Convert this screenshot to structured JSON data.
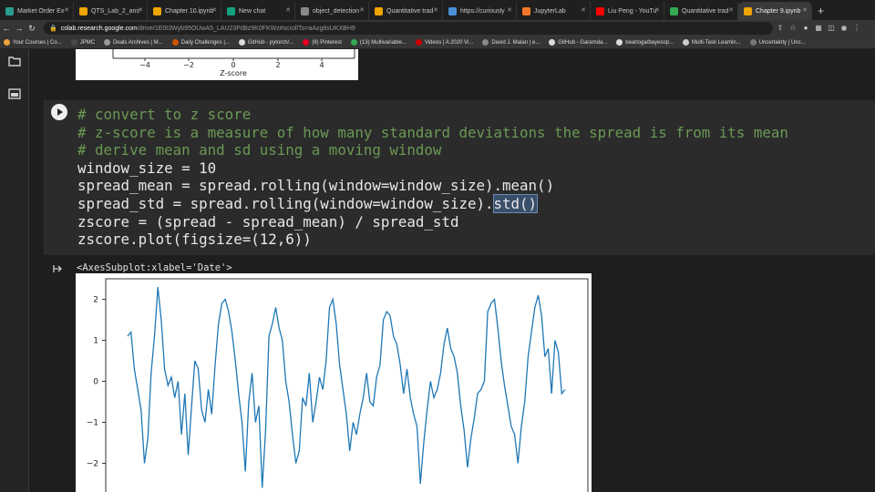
{
  "browser": {
    "tabs": [
      {
        "label": "Market Order Ex",
        "color": "#2a9d8f"
      },
      {
        "label": "QTS_Lab_2_ans",
        "color": "#f0a500"
      },
      {
        "label": "Chapter 10.ipynb",
        "color": "#f0a500"
      },
      {
        "label": "New chat",
        "color": "#10a37f"
      },
      {
        "label": "object_detection",
        "color": "#888888"
      },
      {
        "label": "Quantitative trad",
        "color": "#f0a500"
      },
      {
        "label": "https://curiously",
        "color": "#4a90d9"
      },
      {
        "label": "JupyterLab",
        "color": "#f37726"
      },
      {
        "label": "Liu Peng - YouTu",
        "color": "#ff0000"
      },
      {
        "label": "Quantitative trad",
        "color": "#34a853"
      },
      {
        "label": "Chapter 9.ipynb",
        "color": "#f0a500"
      }
    ],
    "new_tab": "+",
    "url_host": "colab.research.google.com",
    "url_path": "/drive/1E0t3Wyb95OUwA5_LAU23Pd8z9K0FKWz#scrollTo=aAzg8sUKXBH9",
    "bookmarks": [
      "Your Courses | Co...",
      "JPMC",
      "Deals Archives | M...",
      "Daily Challenges |...",
      "GitHub - pytorch/...",
      "(8) Pinterest",
      "(13) Multivariable...",
      "Videos | A 2020 Vi...",
      "David J. Malan | e...",
      "GitHub - Garamda...",
      "bearloga/bayesop...",
      "Multi-Task Learnin...",
      "Uncertainty | Unc..."
    ]
  },
  "notebook": {
    "prev_axis_ticks": [
      "−4",
      "−2",
      "0",
      "2",
      "4"
    ],
    "prev_axis_label": "Z-score",
    "code_lines": {
      "c1": "# convert to z score",
      "c2": "# z-score is a measure of how many standard deviations the spread is from its mean",
      "c3": "# derive mean and sd using a moving window",
      "l4": "window_size = 10",
      "l5": "spread_mean = spread.rolling(window=window_size).mean()",
      "l6a": "spread_std = spread.rolling(window=window_size).",
      "l6b": "std()",
      "l7": "zscore = (spread - spread_mean) / spread_std",
      "l8": "zscore.plot(figsize=(12,6))"
    },
    "output_text": "<AxesSubplot:xlabel='Date'>"
  },
  "chart_data": {
    "type": "line",
    "ylim": [
      -2.7,
      2.5
    ],
    "yticks": [
      2,
      1,
      0,
      -1,
      -2
    ],
    "color": "#1f77b4",
    "values": [
      1.1,
      1.2,
      0.3,
      -0.2,
      -0.7,
      -2.0,
      -1.4,
      0.2,
      1.1,
      2.3,
      1.5,
      0.3,
      -0.1,
      0.1,
      -0.4,
      0.0,
      -1.3,
      -0.3,
      -1.8,
      -0.6,
      0.5,
      0.3,
      -0.7,
      -1.0,
      -0.2,
      -0.8,
      0.4,
      1.4,
      1.9,
      2.0,
      1.7,
      1.2,
      0.5,
      -0.3,
      -1.0,
      -2.2,
      -0.5,
      0.2,
      -1.0,
      -0.6,
      -2.6,
      -1.2,
      1.1,
      1.4,
      1.8,
      1.3,
      1.0,
      0.0,
      -0.5,
      -1.3,
      -2.0,
      -1.7,
      -0.4,
      -0.6,
      0.2,
      -1.0,
      -0.5,
      0.1,
      -0.2,
      0.5,
      1.8,
      2.0,
      1.4,
      0.4,
      -0.2,
      -0.8,
      -1.7,
      -1.0,
      -1.3,
      -0.8,
      -0.4,
      0.2,
      -0.5,
      -0.6,
      0.1,
      0.4,
      1.5,
      1.7,
      1.6,
      1.1,
      0.9,
      0.4,
      -0.3,
      0.3,
      -0.4,
      -0.8,
      -1.1,
      -2.5,
      -1.5,
      -0.7,
      0.0,
      -0.4,
      -0.2,
      0.2,
      0.9,
      1.3,
      0.8,
      0.6,
      0.2,
      -0.6,
      -1.2,
      -2.1,
      -1.4,
      -0.9,
      -0.3,
      -0.2,
      0.0,
      1.7,
      1.9,
      2.0,
      1.3,
      0.5,
      -0.1,
      -0.6,
      -1.1,
      -1.3,
      -2.0,
      -1.1,
      -0.5,
      0.6,
      1.2,
      1.8,
      2.1,
      1.6,
      0.6,
      0.8,
      -0.3,
      1.0,
      0.7,
      -0.3,
      -0.2
    ]
  }
}
